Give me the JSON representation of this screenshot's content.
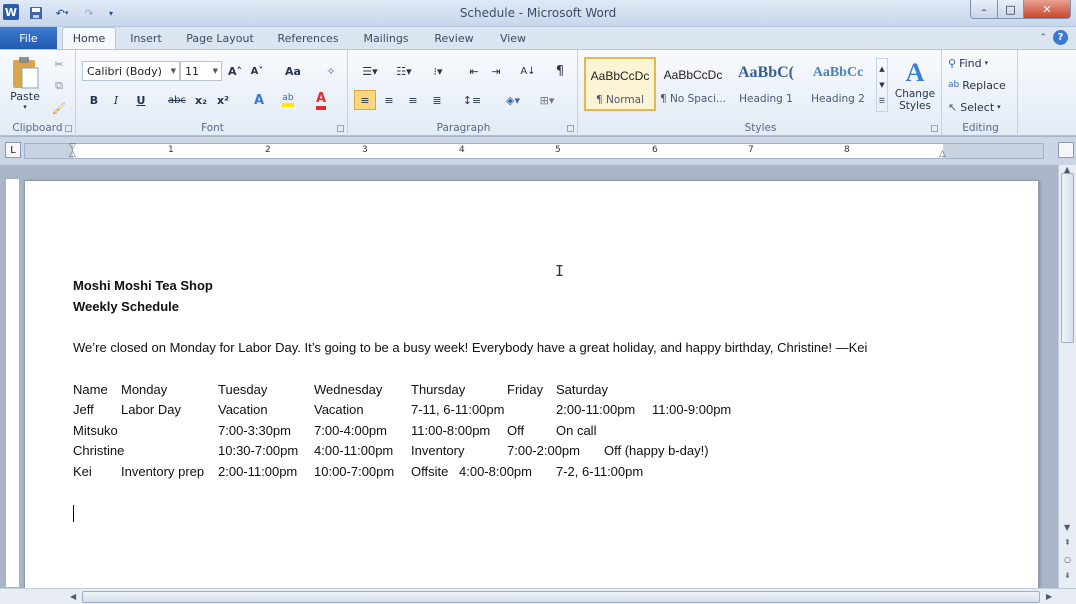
{
  "window": {
    "title": "Schedule - Microsoft Word",
    "app_icon": "W",
    "minimize": "–",
    "maximize": "□",
    "close": "✕"
  },
  "ribbon_tabs": {
    "file": "File",
    "items": [
      "Home",
      "Insert",
      "Page Layout",
      "References",
      "Mailings",
      "Review",
      "View"
    ]
  },
  "ribbon": {
    "clipboard": {
      "label": "Clipboard",
      "paste": "Paste"
    },
    "font": {
      "label": "Font",
      "font_name": "Calibri (Body)",
      "font_size": "11",
      "bold": "B",
      "italic": "I",
      "underline": "U",
      "strikethrough": "abc",
      "subscript": "x₂",
      "superscript": "x²",
      "grow": "A˄",
      "shrink": "A˅",
      "change_case": "Aa"
    },
    "paragraph": {
      "label": "Paragraph",
      "pilcrow": "¶"
    },
    "styles": {
      "label": "Styles",
      "tiles": [
        {
          "sample": "AaBbCcDc",
          "name": "¶ Normal"
        },
        {
          "sample": "AaBbCcDc",
          "name": "¶ No Spaci..."
        },
        {
          "sample": "AaBbC(",
          "name": "Heading 1"
        },
        {
          "sample": "AaBbCc",
          "name": "Heading 2"
        }
      ],
      "change_styles": "Change Styles"
    },
    "editing": {
      "label": "Editing",
      "find": "Find",
      "replace": "Replace",
      "select": "Select"
    }
  },
  "document": {
    "heading1": "Moshi Moshi Tea Shop",
    "heading2": "Weekly Schedule",
    "note": "We’re closed on Monday for Labor Day. It’s going to be a busy week! Everybody have a great holiday, and happy birthday, Christine! —Kei",
    "schedule": {
      "header": [
        "Name",
        "Monday",
        "Tuesday",
        "Wednesday",
        "Thursday",
        "Friday",
        "Saturday"
      ],
      "rows": [
        [
          "Jeff",
          "Labor Day",
          "Vacation",
          "Vacation",
          "7-11, 6-11:00pm",
          "",
          "2:00-11:00pm",
          "11:00-9:00pm"
        ],
        [
          "Mitsuko",
          "",
          "7:00-3:30pm",
          "7:00-4:00pm",
          "11:00-8:00pm",
          "Off",
          "On call"
        ],
        [
          "Christine",
          "",
          "10:30-7:00pm",
          "4:00-11:00pm",
          "Inventory",
          "7:00-2:00pm",
          "Off (happy b-day!)"
        ],
        [
          "Kei",
          "Inventory prep",
          "2:00-11:00pm",
          "10:00-7:00pm",
          "Offsite",
          "4:00-8:00pm",
          "7-2, 6-11:00pm"
        ]
      ]
    }
  },
  "ruler_numbers": [
    "1",
    "2",
    "3",
    "4",
    "5",
    "6",
    "7",
    "8"
  ]
}
